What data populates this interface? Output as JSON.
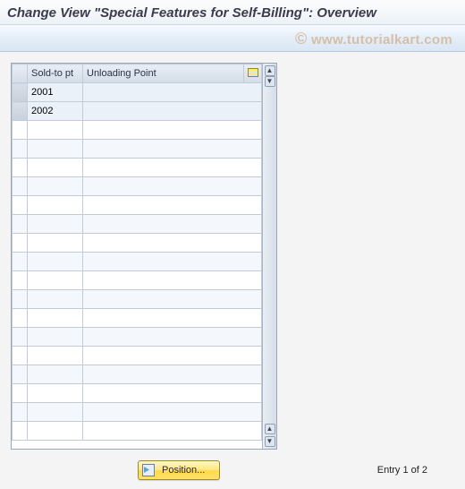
{
  "window": {
    "title": "Change View \"Special Features for Self-Billing\": Overview"
  },
  "watermark": "www.tutorialkart.com",
  "grid": {
    "columns": {
      "sold_to": "Sold-to pt",
      "unloading": "Unloading Point"
    },
    "rows": [
      {
        "sold_to": "2001",
        "unloading": ""
      },
      {
        "sold_to": "2002",
        "unloading": ""
      }
    ],
    "empty_row_count": 17
  },
  "footer": {
    "position_label": "Position...",
    "entry_text": "Entry 1 of 2"
  }
}
